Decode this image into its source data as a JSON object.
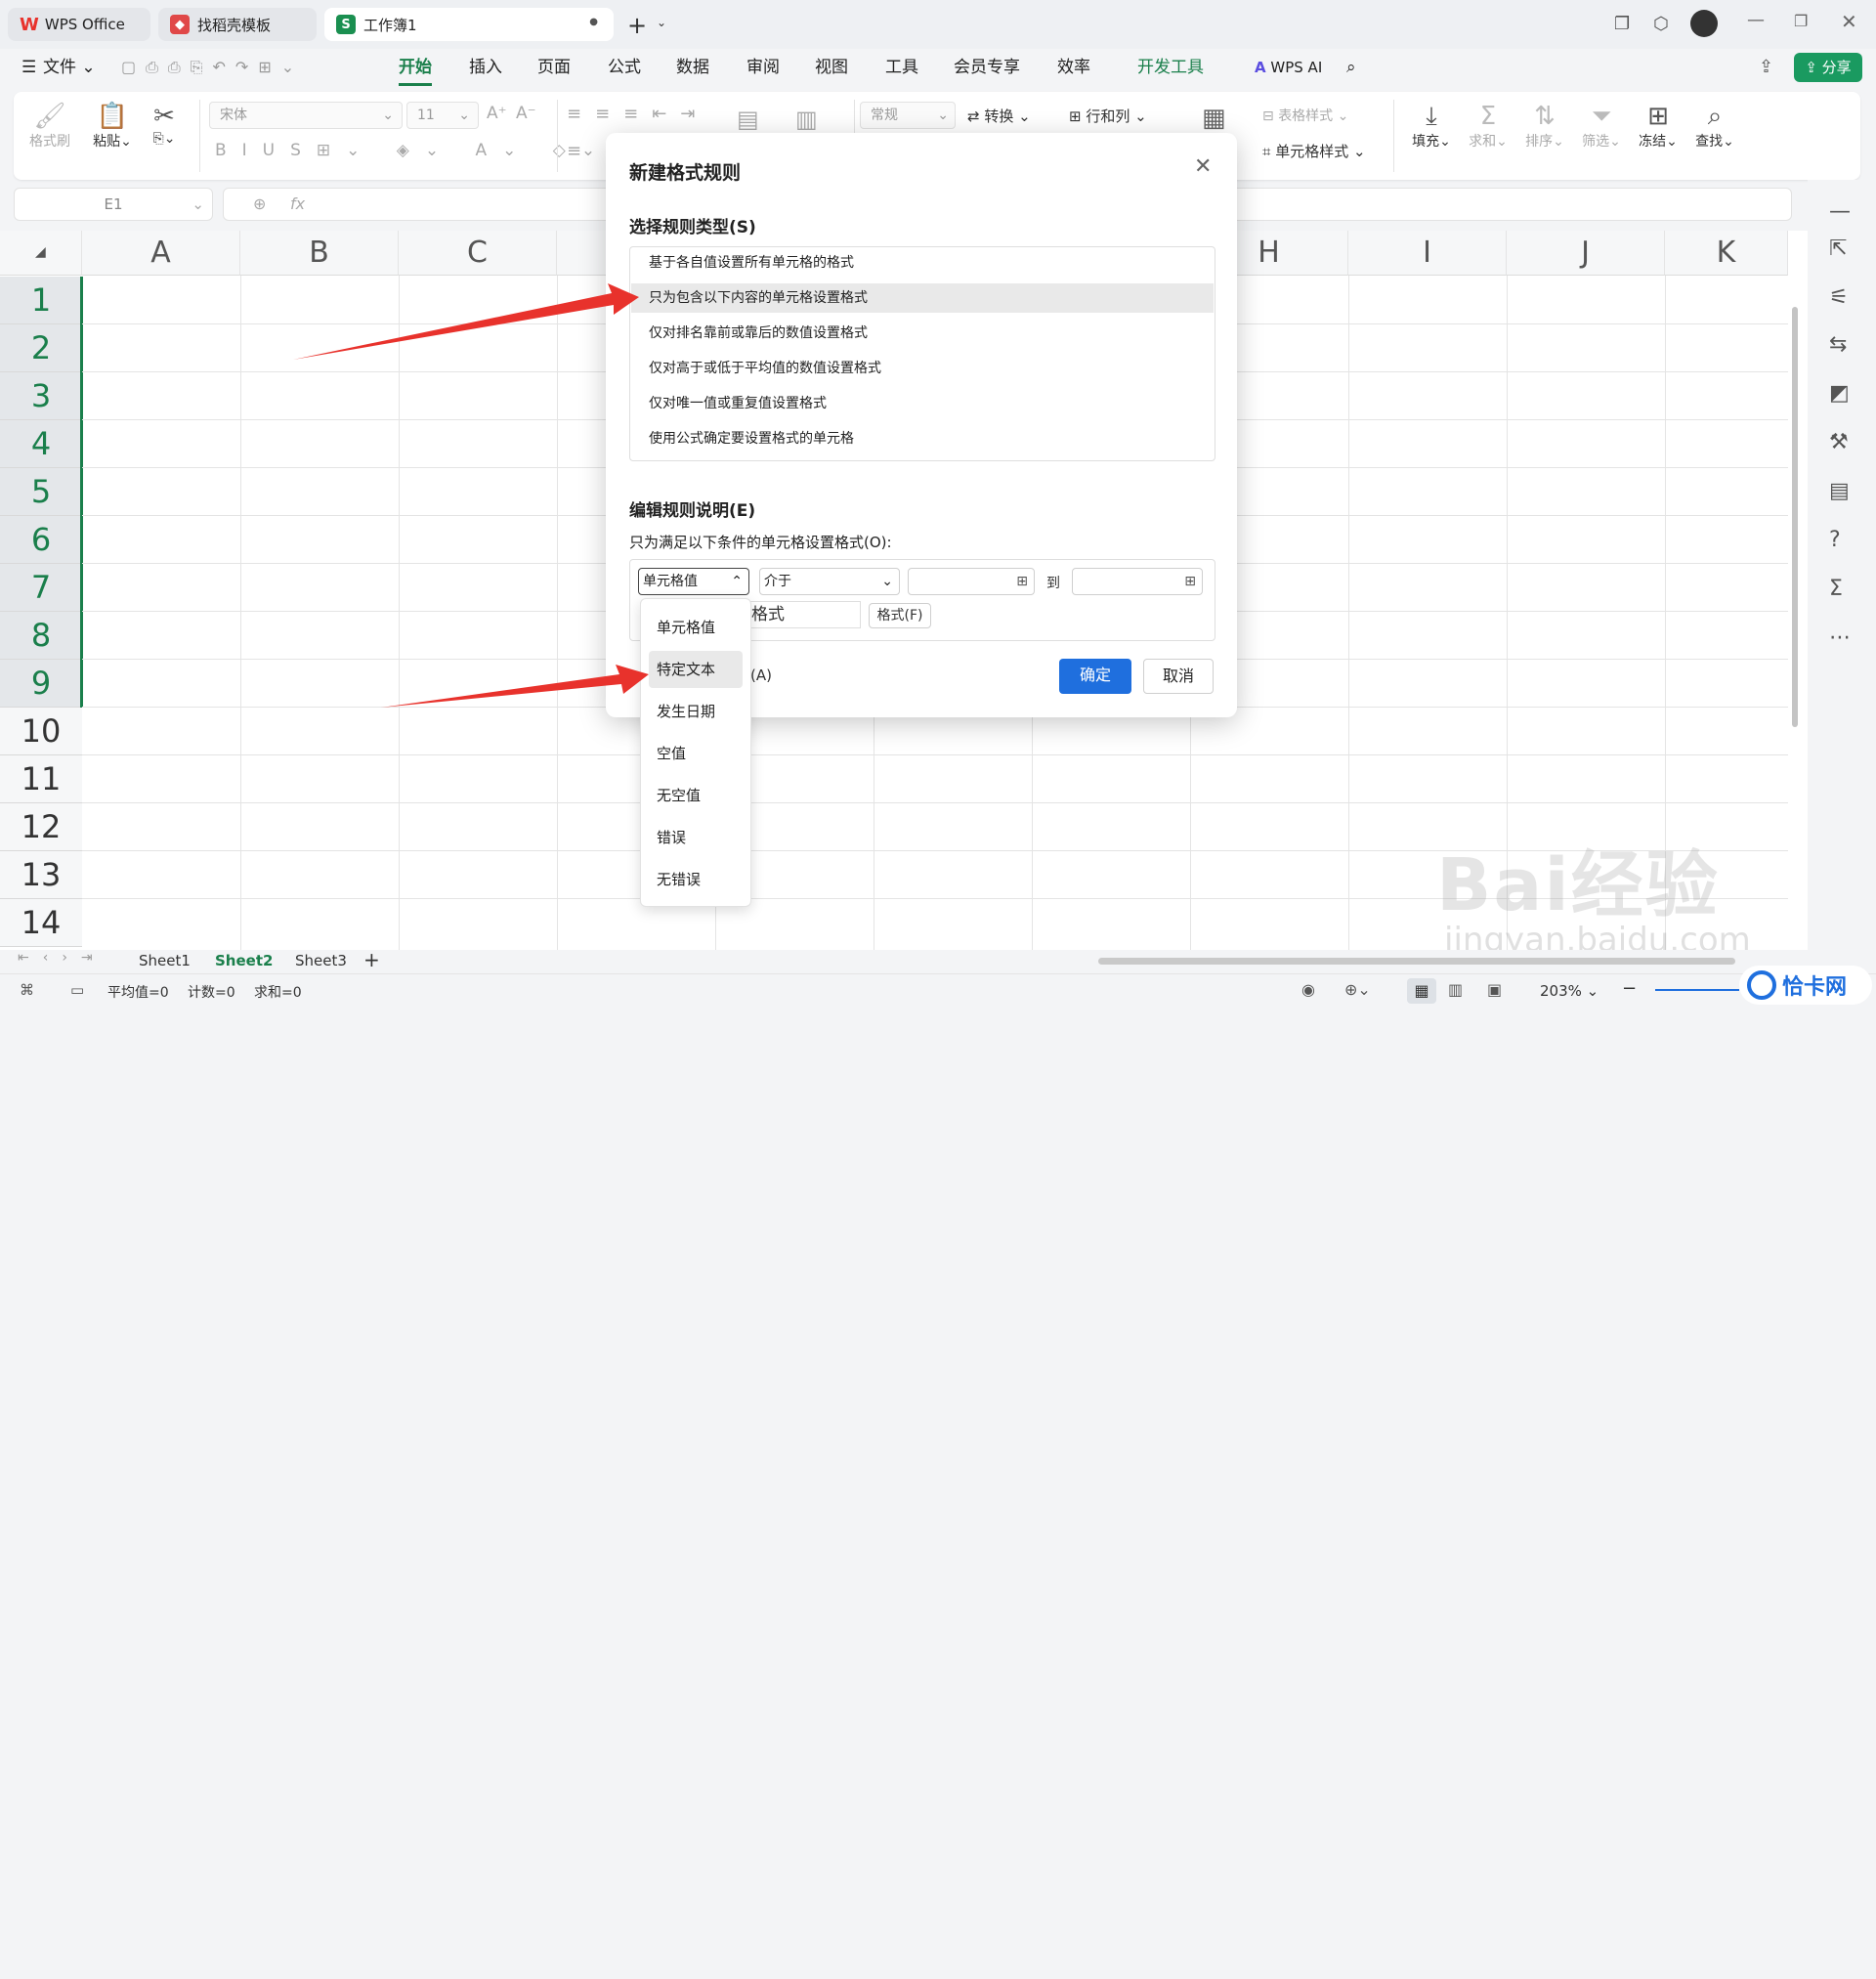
{
  "tabs": [
    {
      "label": "WPS Office"
    },
    {
      "label": "找稻壳模板"
    },
    {
      "label": "工作簿1"
    }
  ],
  "menu": {
    "file": "文件",
    "items": [
      "开始",
      "插入",
      "页面",
      "公式",
      "数据",
      "审阅",
      "视图",
      "工具",
      "会员专享",
      "效率",
      "开发工具"
    ],
    "ai": "WPS AI",
    "share": "分享"
  },
  "ribbon": {
    "format_painter": "格式刷",
    "paste": "粘贴",
    "font": "宋体",
    "size": "11",
    "number_format": "常规",
    "convert": "转换",
    "rows_cols": "行和列",
    "table_style": "表格样式",
    "cell_style": "单元格样式",
    "fill": "填充",
    "sum": "求和",
    "sort": "排序",
    "filter": "筛选",
    "freeze": "冻结",
    "find": "查找"
  },
  "formula": {
    "cell_ref": "E1",
    "fx": "fx"
  },
  "columns": [
    "A",
    "B",
    "C",
    "",
    "",
    "",
    "",
    "H",
    "I",
    "J",
    "K"
  ],
  "rows": [
    "1",
    "2",
    "3",
    "4",
    "5",
    "6",
    "7",
    "8",
    "9",
    "10",
    "11",
    "12",
    "13",
    "14"
  ],
  "sheets": [
    "Sheet1",
    "Sheet2",
    "Sheet3"
  ],
  "status": {
    "avg": "平均值=0",
    "count": "计数=0",
    "sum": "求和=0",
    "zoom": "203%"
  },
  "dialog": {
    "title": "新建格式规则",
    "select_type_label": "选择规则类型(S)",
    "rule_types": [
      "基于各自值设置所有单元格的格式",
      "只为包含以下内容的单元格设置格式",
      "仅对排名靠前或靠后的数值设置格式",
      "仅对高于或低于平均值的数值设置格式",
      "仅对唯一值或重复值设置格式",
      "使用公式确定要设置格式的单元格"
    ],
    "edit_label": "编辑规则说明(E)",
    "condition_label": "只为满足以下条件的单元格设置格式(O):",
    "field1": "单元格值",
    "field2": "介于",
    "to_label": "到",
    "preview_text": "定格式",
    "format_button": "格式(F)",
    "a_hint": "(A)",
    "ok": "确定",
    "cancel": "取消"
  },
  "dropdown_items": [
    "单元格值",
    "特定文本",
    "发生日期",
    "空值",
    "无空值",
    "错误",
    "无错误"
  ],
  "watermark": {
    "brand": "Bai经验",
    "url": "jingyan.baidu.com",
    "corner": "恰卡网"
  },
  "colors": {
    "accent_green": "#1a7f4b",
    "ok_blue": "#1f6fde",
    "arrow_red": "#e8322c"
  }
}
